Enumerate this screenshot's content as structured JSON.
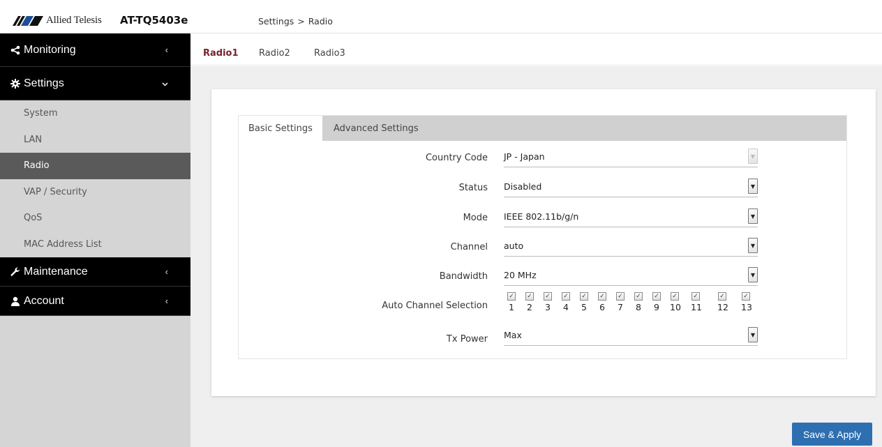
{
  "header": {
    "brand": "Allied Telesis",
    "product": "AT-TQ5403e",
    "breadcrumb": [
      "Settings",
      ">",
      "Radio"
    ]
  },
  "sidebar": {
    "groups": [
      {
        "label": "Monitoring",
        "icon": "share-icon",
        "chevron": "‹"
      },
      {
        "label": "Settings",
        "icon": "gear-icon",
        "chevron": "⌄"
      },
      {
        "label": "Maintenance",
        "icon": "wrench-icon",
        "chevron": "‹"
      },
      {
        "label": "Account",
        "icon": "user-icon",
        "chevron": "‹"
      }
    ],
    "settings_items": [
      {
        "label": "System"
      },
      {
        "label": "LAN"
      },
      {
        "label": "Radio",
        "active": true
      },
      {
        "label": "VAP / Security"
      },
      {
        "label": "QoS"
      },
      {
        "label": "MAC Address List"
      }
    ]
  },
  "tabs": [
    {
      "label": "Radio1",
      "active": true
    },
    {
      "label": "Radio2"
    },
    {
      "label": "Radio3"
    }
  ],
  "inner_tabs": [
    {
      "label": "Basic Settings",
      "active": true
    },
    {
      "label": "Advanced Settings"
    }
  ],
  "form": {
    "country_code": {
      "label": "Country Code",
      "value": "JP - Japan",
      "disabled": true
    },
    "status": {
      "label": "Status",
      "value": "Disabled"
    },
    "mode": {
      "label": "Mode",
      "value": "IEEE 802.11b/g/n"
    },
    "channel": {
      "label": "Channel",
      "value": "auto"
    },
    "bandwidth": {
      "label": "Bandwidth",
      "value": "20 MHz"
    },
    "auto_channel": {
      "label": "Auto Channel Selection",
      "channels": [
        "1",
        "2",
        "3",
        "4",
        "5",
        "6",
        "7",
        "8",
        "9",
        "10",
        "11",
        "12",
        "13"
      ],
      "checked": [
        true,
        true,
        true,
        true,
        true,
        true,
        true,
        true,
        true,
        true,
        true,
        true,
        true
      ]
    },
    "tx_power": {
      "label": "Tx Power",
      "value": "Max"
    }
  },
  "actions": {
    "save_label": "Save & Apply"
  },
  "colors": {
    "sidebar_bg": "#000000",
    "active_tab": "#7a1f2b",
    "save_button": "#2d6fb0"
  }
}
